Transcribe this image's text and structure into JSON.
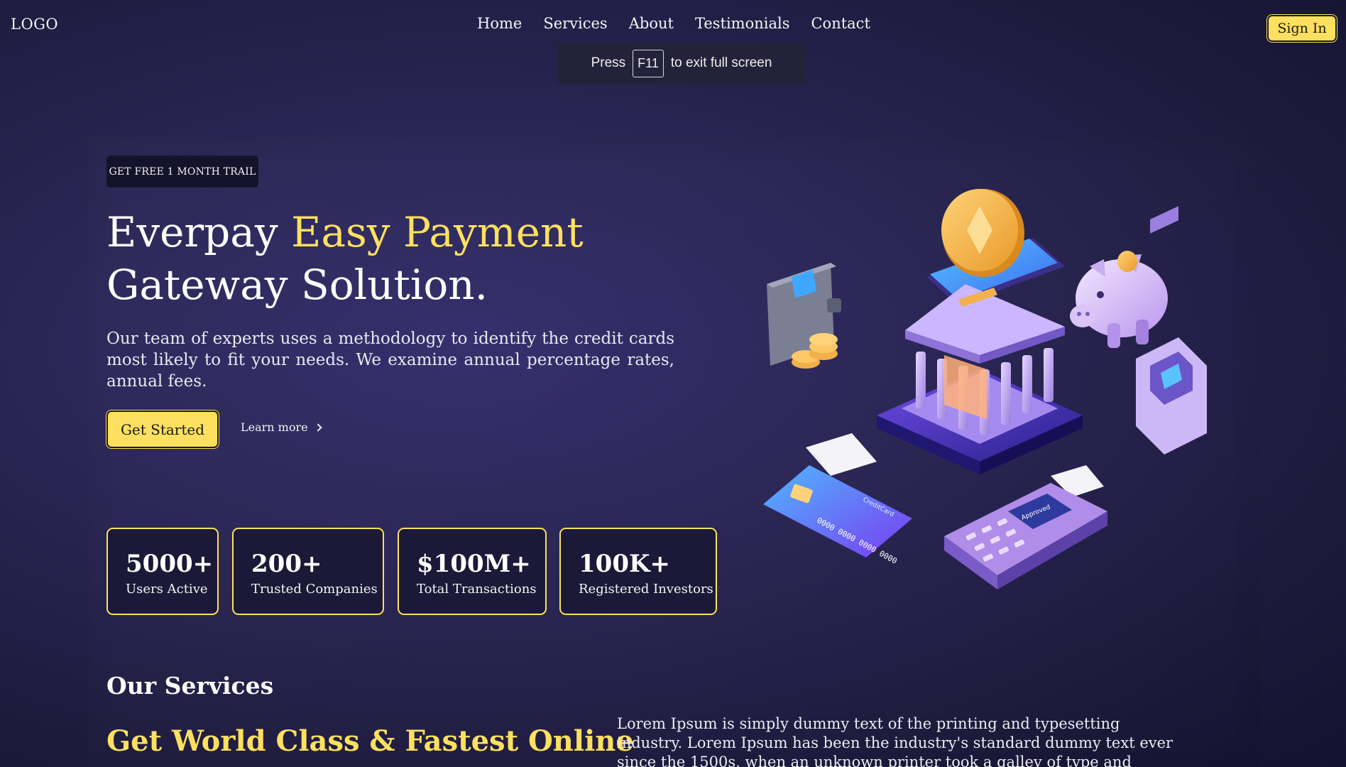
{
  "header": {
    "logo": "LOGO",
    "nav": [
      "Home",
      "Services",
      "About",
      "Testimonials",
      "Contact"
    ],
    "sign_in": "Sign In"
  },
  "fullscreen_notice": {
    "before": "Press",
    "key": "F11",
    "after": "to exit full screen"
  },
  "hero": {
    "badge": "GET FREE 1 MONTH TRAIL",
    "title_part1": "Everpay ",
    "title_accent": "Easy Payment",
    "title_part2": "Gateway Solution.",
    "description": "Our team of experts uses a methodology to identify the credit cards most likely to fit your needs. We examine annual percentage rates, annual fees.",
    "cta_primary": "Get Started",
    "cta_secondary": "Learn more"
  },
  "stats": [
    {
      "value": "5000+",
      "label": "Users Active"
    },
    {
      "value": "200+",
      "label": "Trusted Companies"
    },
    {
      "value": "$100M+",
      "label": "Total Transactions"
    },
    {
      "value": "100K+",
      "label": "Registered Investors"
    }
  ],
  "services": {
    "title": "Our Services",
    "subtitle": "Get World Class & Fastest Online",
    "body": "Lorem Ipsum is simply dummy text of the printing and typesetting industry. Lorem Ipsum has been the industry's standard dummy text ever since the 1500s, when an unknown printer took a galley of type and scrambled it to make a type specimen"
  },
  "colors": {
    "accent": "#fde05f",
    "background": "#27234f",
    "card": "#1b1937"
  },
  "illustration": {
    "card_number": "0000 0000 0000 0000",
    "card_brand": "CreditCard",
    "terminal_text": "Approved"
  }
}
